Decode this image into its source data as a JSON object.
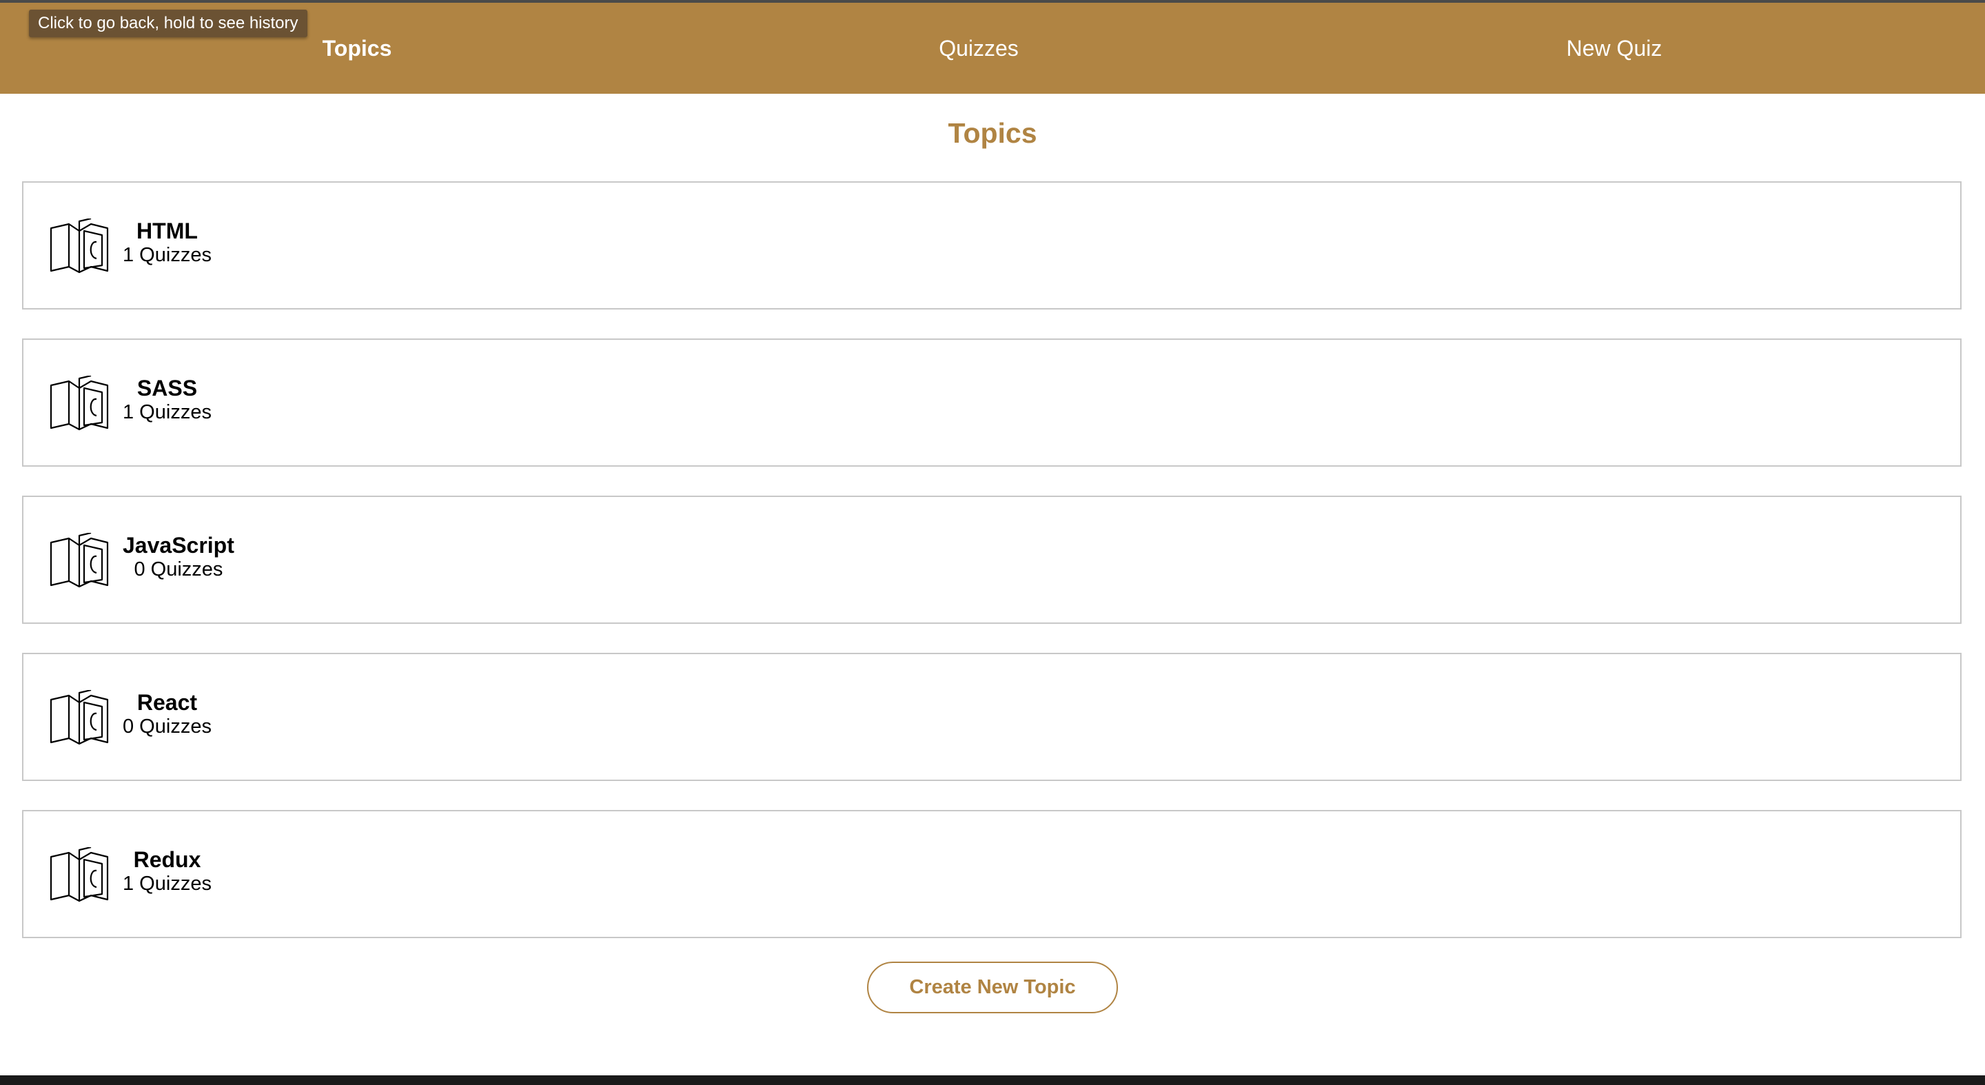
{
  "tooltip": {
    "text": "Click to go back, hold to see history"
  },
  "nav": {
    "items": [
      {
        "label": "Topics",
        "active": true
      },
      {
        "label": "Quizzes",
        "active": false
      },
      {
        "label": "New Quiz",
        "active": false
      }
    ]
  },
  "page_title": "Topics",
  "topics": [
    {
      "name": "HTML",
      "count": "1 Quizzes",
      "icon": "book-icon"
    },
    {
      "name": "SASS",
      "count": "1 Quizzes",
      "icon": "book-icon"
    },
    {
      "name": "JavaScript",
      "count": "0 Quizzes",
      "icon": "book-icon"
    },
    {
      "name": "React",
      "count": "0 Quizzes",
      "icon": "book-icon"
    },
    {
      "name": "Redux",
      "count": "1 Quizzes",
      "icon": "book-icon"
    }
  ],
  "create_button": {
    "label": "Create New Topic"
  },
  "colors": {
    "accent": "#b08443",
    "tooltip_bg": "#6b5233",
    "card_border": "#c8c8c8"
  }
}
